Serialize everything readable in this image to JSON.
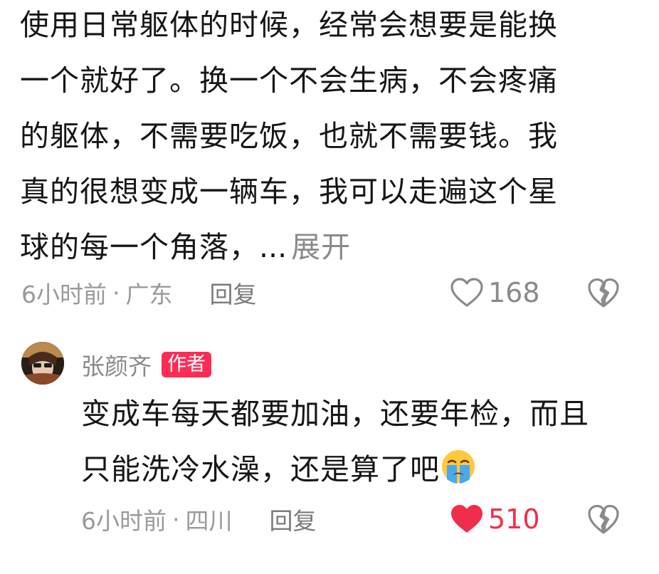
{
  "comment1": {
    "lines": [
      "使用日常躯体的时候，经常会想要是能换",
      "一个就好了。换一个不会生病，不会疼痛",
      "的躯体，不需要吃饭，也就不需要钱。我",
      "真的很想变成一辆车，我可以走遍这个星",
      "球的每一个角落，"
    ],
    "ellipsis": "...",
    "expand_label": "展开",
    "time": "6小时前",
    "separator": "·",
    "location": "广东",
    "reply_label": "回复",
    "like_count": "168",
    "liked": false
  },
  "comment2": {
    "author": "张颜齐",
    "author_badge": "作者",
    "lines": [
      "变成车每天都要加油，还要年检，而且",
      "只能洗冷水澡，还是算了吧"
    ],
    "emoji_icon": "loudly-crying-face-icon",
    "time": "6小时前",
    "separator": "·",
    "location": "四川",
    "reply_label": "回复",
    "like_count": "510",
    "liked": true
  },
  "colors": {
    "like_active": "#f02d4b",
    "author_badge_bg": "#fe2c55",
    "meta_text": "#9a9a9a"
  }
}
